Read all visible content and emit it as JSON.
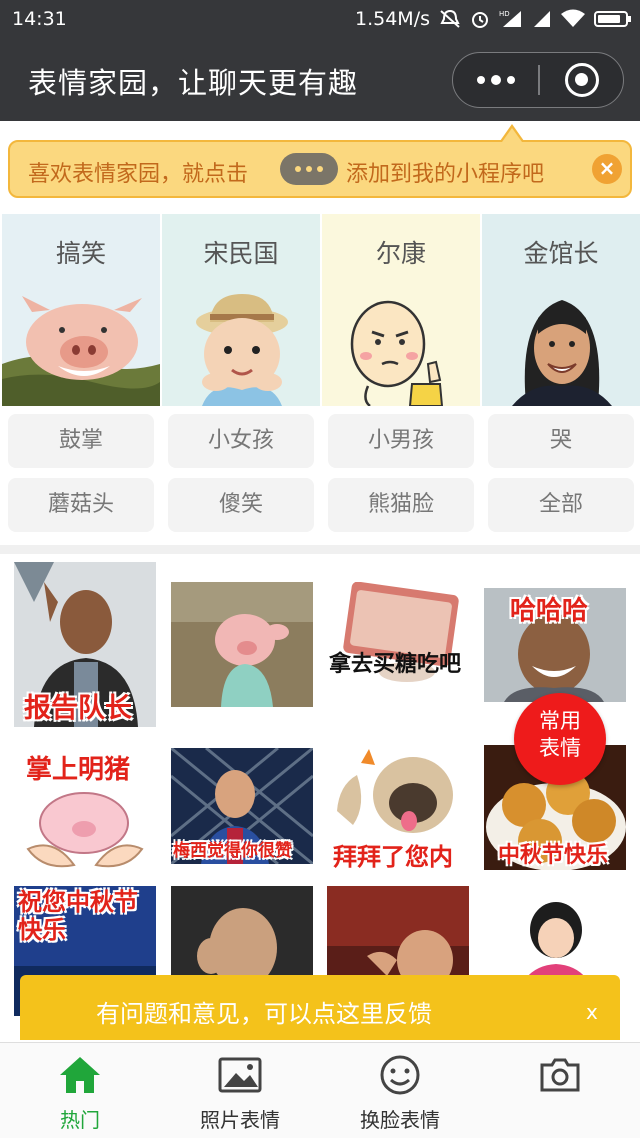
{
  "status_bar": {
    "time": "14:31",
    "network_speed": "1.54M/s",
    "hd_label": "HD"
  },
  "header": {
    "title": "表情家园，让聊天更有趣"
  },
  "tip": {
    "text_before": "喜欢表情家园，就点击",
    "text_after": "添加到我的小程序吧",
    "close": "×"
  },
  "categories": [
    {
      "label": "搞笑",
      "bg": "#e5f0f4"
    },
    {
      "label": "宋民国",
      "bg": "#e1f1ef"
    },
    {
      "label": "尔康",
      "bg": "#fbf8dd"
    },
    {
      "label": "金馆长",
      "bg": "#dfeef0"
    }
  ],
  "tags": [
    "鼓掌",
    "小女孩",
    "小男孩",
    "哭",
    "蘑菇头",
    "傻笑",
    "熊猫脸",
    "全部"
  ],
  "stickers": [
    {
      "caption": "报告队长"
    },
    {
      "caption": ""
    },
    {
      "caption": "拿去买糖吃吧"
    },
    {
      "caption": "哈哈哈"
    },
    {
      "caption": "掌上明猪"
    },
    {
      "caption": "梅西觉得你很赞"
    },
    {
      "caption": "拜拜了您内"
    },
    {
      "caption": "中秋节快乐"
    },
    {
      "caption": "祝您中秋节快乐"
    },
    {
      "caption": ""
    },
    {
      "caption": ""
    },
    {
      "caption": ""
    }
  ],
  "fab": {
    "line1": "常用",
    "line2": "表情"
  },
  "feedback": {
    "text": "有问题和意见，可以点这里反馈",
    "close": "x"
  },
  "tabbar": [
    {
      "label": "热门",
      "icon": "home-icon",
      "active": true
    },
    {
      "label": "照片表情",
      "icon": "image-icon",
      "active": false
    },
    {
      "label": "换脸表情",
      "icon": "smiley-icon",
      "active": false
    },
    {
      "label": "",
      "icon": "camera-icon",
      "active": false
    }
  ],
  "colors": {
    "accent_green": "#20a63a",
    "tip_bg": "#fbd87f",
    "feedback_bg": "#f4c21b",
    "fab_red": "#ee1b1b"
  }
}
